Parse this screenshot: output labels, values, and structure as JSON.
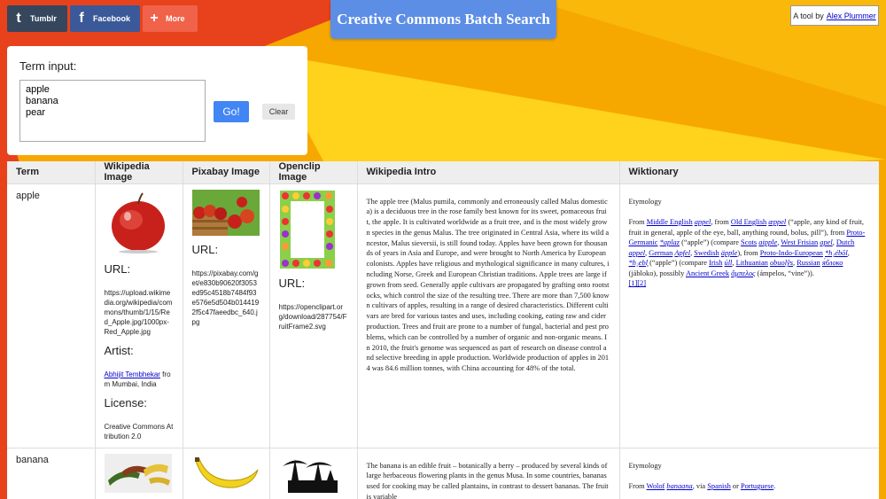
{
  "header": {
    "title": "Creative Commons Batch Search",
    "share": [
      {
        "label": "Tumblr",
        "icon": "tumblr-icon",
        "glyph": "t"
      },
      {
        "label": "Facebook",
        "icon": "facebook-icon",
        "glyph": "f"
      },
      {
        "label": "More",
        "icon": "plus-icon",
        "glyph": "+"
      }
    ],
    "tool_prefix": "A tool by",
    "tool_author": "Alex Plummer"
  },
  "input": {
    "label": "Term input:",
    "value": "apple\nbanana\npear",
    "go_label": "Go!",
    "clear_label": "Clear"
  },
  "table": {
    "columns": [
      "Term",
      "Wikipedia Image",
      "Pixabay Image",
      "Openclip Image",
      "Wikipedia Intro",
      "Wiktionary"
    ],
    "rows": [
      {
        "term": "apple",
        "wikipedia": {
          "url_label": "URL:",
          "url": "https://upload.wikimedia.org/wikipedia/commons/thumb/1/15/Red_Apple.jpg/1000px-Red_Apple.jpg",
          "artist_label": "Artist:",
          "artist_name": "Abhijit Tembhekar",
          "artist_rest": " from Mumbai, India",
          "license_label": "License:",
          "license": "Creative Commons Attribution 2.0"
        },
        "pixabay": {
          "url_label": "URL:",
          "url": "https://pixabay.com/get/e830b90620f3053ed95c4518b7484f93e576e5d504b0144192f5c47faeedbc_640.jpg"
        },
        "openclip": {
          "url_label": "URL:",
          "url": "https://openclipart.org/download/287754/FruitFrame2.svg"
        },
        "intro": "The apple tree (Malus pumila, commonly and erroneously called Malus domestica) is a deciduous tree in the rose family best known for its sweet, pomaceous fruit, the apple. It is cultivated worldwide as a fruit tree, and is the most widely grown species in the genus Malus. The tree originated in Central Asia, where its wild ancestor, Malus sieversii, is still found today. Apples have been grown for thousands of years in Asia and Europe, and were brought to North America by European colonists. Apples have religious and mythological significance in many cultures, including Norse, Greek and European Christian traditions. Apple trees are large if grown from seed. Generally apple cultivars are propagated by grafting onto rootstocks, which control the size of the resulting tree. There are more than 7,500 known cultivars of apples, resulting in a range of desired characteristics. Different cultivars are bred for various tastes and uses, including cooking, eating raw and cider production. Trees and fruit are prone to a number of fungal, bacterial and pest problems, which can be controlled by a number of organic and non-organic means. In 2010, the fruit's genome was sequenced as part of research on disease control and selective breeding in apple production. Worldwide production of apples in 2014 was 84.6 million tonnes, with China accounting for 48% of the total.",
        "wiktionary": {
          "heading": "Etymology",
          "t1": "From ",
          "l1": "Middle English",
          "t2": " ",
          "l2": "appel",
          "t3": ", from ",
          "l3": "Old English",
          "t4": " ",
          "l4": "æppel",
          "t5": " (“apple, any kind of fruit, fruit in general, apple of the eye, ball, anything round, bolus, pill”), from ",
          "l5": "Proto-Germanic",
          "t6": " ",
          "l6": "*aplaz",
          "t7": " (“apple”) (compare ",
          "l7": "Scots",
          "t8": " ",
          "l8": "aipple",
          "t9": ", ",
          "l9": "West Frisian",
          "t10": " ",
          "l10": "apel",
          "t11": ", ",
          "l11": "Dutch",
          "t12": " ",
          "l12": "appel",
          "t13": ", ",
          "l13": "German",
          "t14": " ",
          "l14": "Apfel",
          "t15": ", ",
          "l15": "Swedish",
          "t16": " ",
          "l16": "äpple",
          "t17": "), from ",
          "l17": "Proto-Indo-European",
          "t18": " ",
          "l18": "*h₂ébōl",
          "t19": ", ",
          "l19": "*h₂ebl̥",
          "t20": " (“apple”) (compare ",
          "l20": "Irish",
          "t21": " ",
          "l21": "úll",
          "t22": ", ",
          "l22": "Lithuanian",
          "t23": " ",
          "l23": "obuolỹs",
          "t24": ", ",
          "l24": "Russian",
          "t25": " ",
          "l25": "я́блоко",
          "t26": " (jábloko), possibly ",
          "l26": "Ancient Greek",
          "t27": " ",
          "l27": "ἄμπελος",
          "t28": " (ámpelos, “vine”)).",
          "refs": "[1][2]"
        }
      },
      {
        "term": "banana",
        "intro": "The banana is an edible fruit – botanically a berry – produced by several kinds of large herbaceous flowering plants in the genus Musa. In some countries, bananas used for cooking may be called plantains, in contrast to dessert bananas. The fruit is variable",
        "wiktionary": {
          "heading": "Etymology",
          "t1": "From ",
          "l1": "Wolof",
          "t2": " ",
          "l2": "banaana",
          "t3": ", via ",
          "l3": "Spanish",
          "t4": " or ",
          "l4": "Portuguese",
          "t5": "."
        }
      }
    ]
  },
  "colors": {
    "background_orange": "#f6a800",
    "background_red": "#e8421c",
    "background_yellow": "#ffd21c",
    "accent_blue": "#5c8ee6",
    "go_blue": "#4285f4",
    "tumblr": "#36465d",
    "facebook": "#3b5998",
    "more": "#f0624a"
  }
}
